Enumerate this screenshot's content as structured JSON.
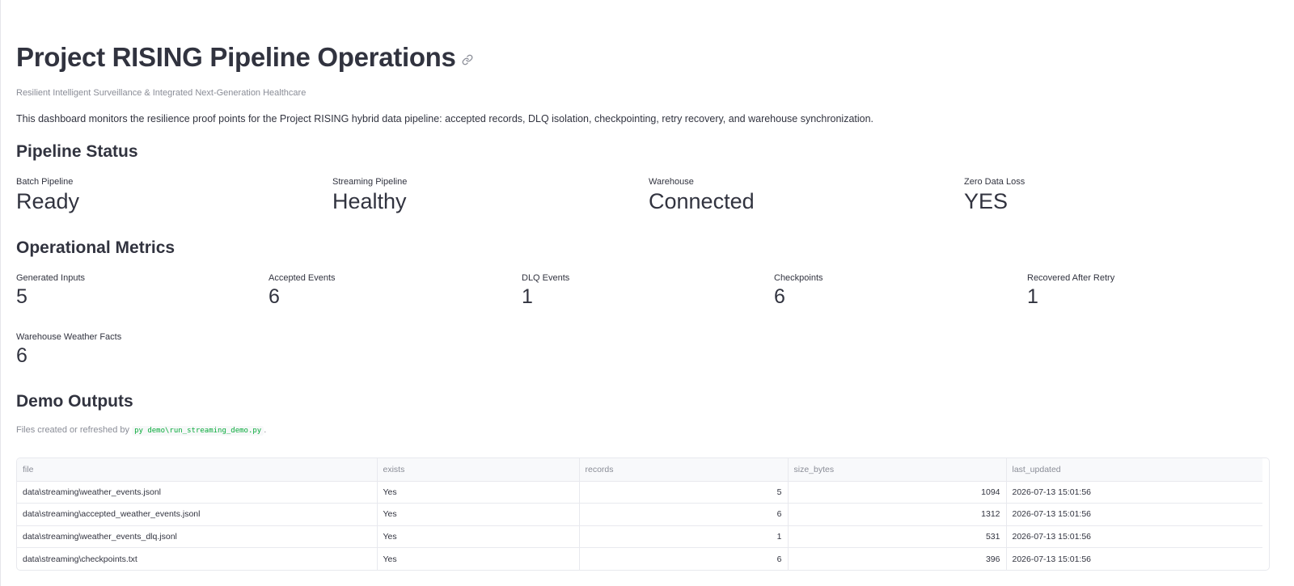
{
  "header": {
    "title": "Project RISING Pipeline Operations",
    "subtitle": "Resilient Intelligent Surveillance & Integrated Next-Generation Healthcare",
    "intro": "This dashboard monitors the resilience proof points for the Project RISING hybrid data pipeline: accepted records, DLQ isolation, checkpointing, retry recovery, and warehouse synchronization."
  },
  "pipeline_status": {
    "heading": "Pipeline Status",
    "items": [
      {
        "label": "Batch Pipeline",
        "value": "Ready"
      },
      {
        "label": "Streaming Pipeline",
        "value": "Healthy"
      },
      {
        "label": "Warehouse",
        "value": "Connected"
      },
      {
        "label": "Zero Data Loss",
        "value": "YES"
      }
    ]
  },
  "operational_metrics": {
    "heading": "Operational Metrics",
    "items": [
      {
        "label": "Generated Inputs",
        "value": "5"
      },
      {
        "label": "Accepted Events",
        "value": "6"
      },
      {
        "label": "DLQ Events",
        "value": "1"
      },
      {
        "label": "Checkpoints",
        "value": "6"
      },
      {
        "label": "Recovered After Retry",
        "value": "1"
      },
      {
        "label": "Warehouse Weather Facts",
        "value": "6"
      }
    ]
  },
  "demo_outputs": {
    "heading": "Demo Outputs",
    "caption_prefix": "Files created or refreshed by",
    "caption_code": "py demo\\run_streaming_demo.py",
    "caption_suffix": ".",
    "columns": [
      "file",
      "exists",
      "records",
      "size_bytes",
      "last_updated"
    ],
    "rows": [
      [
        "data\\streaming\\weather_events.jsonl",
        "Yes",
        "5",
        "1094",
        "2026-07-13 15:01:56"
      ],
      [
        "data\\streaming\\accepted_weather_events.jsonl",
        "Yes",
        "6",
        "1312",
        "2026-07-13 15:01:56"
      ],
      [
        "data\\streaming\\weather_events_dlq.jsonl",
        "Yes",
        "1",
        "531",
        "2026-07-13 15:01:56"
      ],
      [
        "data\\streaming\\checkpoints.txt",
        "Yes",
        "6",
        "396",
        "2026-07-13 15:01:56"
      ]
    ]
  },
  "icons": {
    "title_anchor": "link-icon"
  },
  "colors": {
    "text": "#31333f",
    "muted": "#8a8d97",
    "code": "#09ab3b",
    "border": "#e8e9ee"
  }
}
